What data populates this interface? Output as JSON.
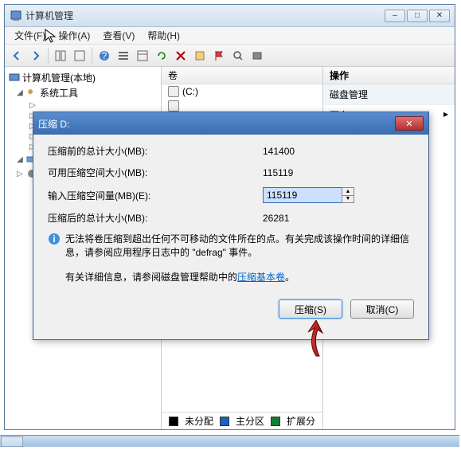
{
  "window": {
    "title": "计算机管理",
    "btn_min": "–",
    "btn_max": "□",
    "btn_close": "✕"
  },
  "menu": {
    "file": "文件(F)",
    "action": "操作(A)",
    "view": "查看(V)",
    "help": "帮助(H)"
  },
  "tree": {
    "root": "计算机管理(本地)",
    "systools": "系统工具"
  },
  "midheader": "卷",
  "volumes": {
    "c": "(C:)"
  },
  "actions": {
    "header": "操作",
    "disk": "磁盘管理",
    "more": "更多...",
    "arrow": "▸"
  },
  "legend": {
    "unalloc": "未分配",
    "primary": "主分区",
    "extended": "扩展分"
  },
  "dialog": {
    "title": "压缩 D:",
    "close": "✕",
    "row1_label": "压缩前的总计大小(MB):",
    "row1_val": "141400",
    "row2_label": "可用压缩空间大小(MB):",
    "row2_val": "115119",
    "row3_label": "输入压缩空间量(MB)(E):",
    "row3_val": "115119",
    "row4_label": "压缩后的总计大小(MB):",
    "row4_val": "26281",
    "info": "无法将卷压缩到超出任何不可移动的文件所在的点。有关完成该操作时间的详细信息，请参阅应用程序日志中的 \"defrag\" 事件。",
    "detail_prefix": "有关详细信息，请参阅磁盘管理帮助中的",
    "detail_link": "压缩基本卷",
    "detail_suffix": "。",
    "btn_shrink": "压缩(S)",
    "btn_cancel": "取消(C)"
  }
}
